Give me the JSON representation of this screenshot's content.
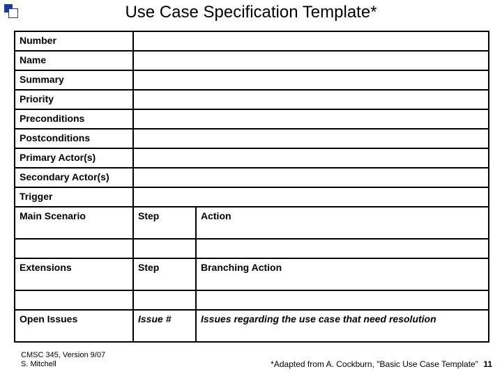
{
  "title": "Use Case Specification Template*",
  "rows": {
    "number": "Number",
    "name": "Name",
    "summary": "Summary",
    "priority": "Priority",
    "preconditions": "Preconditions",
    "postconditions": "Postconditions",
    "primary_actors": "Primary Actor(s)",
    "secondary_actors": "Secondary Actor(s)",
    "trigger": "Trigger",
    "main_scenario": "Main Scenario",
    "step": "Step",
    "action": "Action",
    "extensions": "Extensions",
    "step2": "Step",
    "branching_action": "Branching Action",
    "open_issues": "Open Issues",
    "issue_num": "Issue #",
    "issues_desc": "Issues regarding the use case that need resolution"
  },
  "footer": {
    "course": "CMSC 345, Version 9/07",
    "author": "S. Mitchell",
    "citation": "*Adapted from A. Cockburn, \"Basic Use Case Template\"",
    "page": "11"
  }
}
